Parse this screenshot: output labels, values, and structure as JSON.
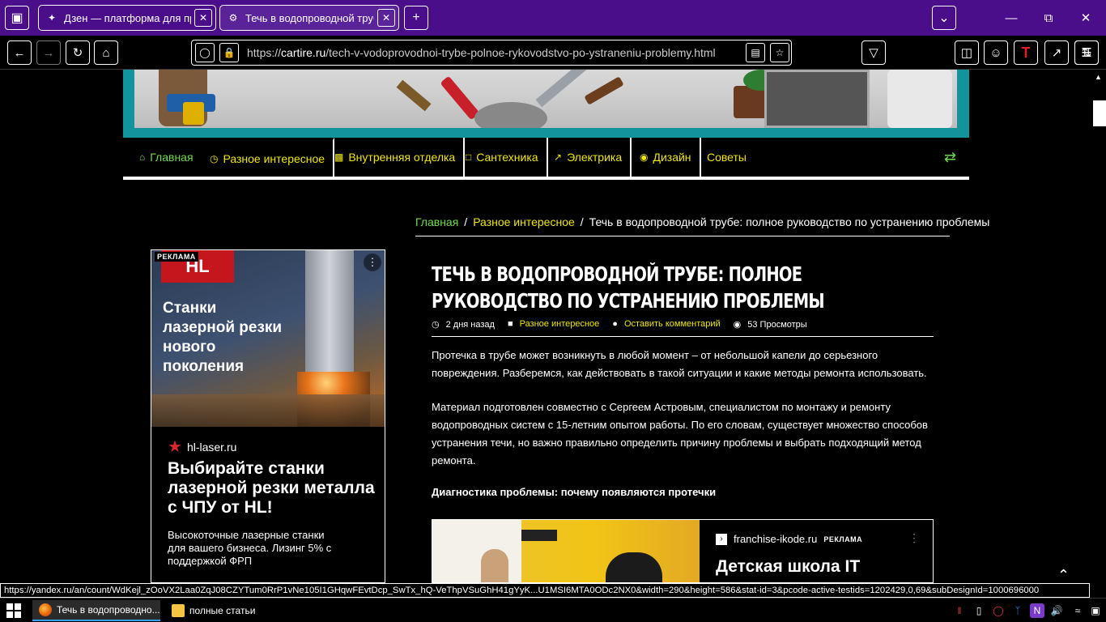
{
  "browser": {
    "tabs": [
      {
        "title": "Дзен — платформа для прос",
        "icon": "dzen-star-icon"
      },
      {
        "title": "Течь в водопроводной трубе",
        "icon": "site-gear-icon"
      }
    ],
    "url_scheme": "https://",
    "url_host": "cartire.ru",
    "url_path": "/tech-v-vodoprovodnoi-trybe-polnoe-rykovodstvo-po-ystraneniu-problemy.html",
    "status_link": "https://yandex.ru/an/count/WdKejl_zOoVX2Laa0ZqJ08CZYTum0RrP1vNe105I1GHqwFEvtDcp_SwTx_hQ-VeThpVSuGhH41gYyK...U1MSI6MTA0ODc2NX0&width=290&height=586&stat-id=3&pcode-active-testids=1202429,0,69&subDesignId=1000696000"
  },
  "site_menu": {
    "items": [
      {
        "label": "Главная",
        "icon": "home-icon"
      },
      {
        "label": "Разное интересное",
        "icon": "clock-icon"
      },
      {
        "label": "Внутренняя отделка",
        "icon": "briefcase-icon"
      },
      {
        "label": "Сантехника",
        "icon": "file-icon"
      },
      {
        "label": "Электрика",
        "icon": "chart-icon"
      },
      {
        "label": "Дизайн",
        "icon": "eye-icon"
      },
      {
        "label": "Советы",
        "icon": ""
      }
    ],
    "random_icon": "shuffle-icon"
  },
  "breadcrumb": {
    "home": "Главная",
    "category": "Разное интересное",
    "current": "Течь в водопроводной трубе: полное руководство по устранению проблемы"
  },
  "article": {
    "title": "Течь в водопроводной трубе: полное руководство по устранению проблемы",
    "meta": {
      "date": "2 дня назад",
      "category": "Разное интересное",
      "comment": "Оставить комментарий",
      "views": "53 Просмотры"
    },
    "paragraph1": "Протечка в трубе может возникнуть в любой момент – от небольшой капели до серьезного повреждения. Разберемся, как действовать в такой ситуации и какие методы ремонта использовать.",
    "paragraph2": "Материал подготовлен совместно с Сергеем Астровым, специалистом по монтажу и ремонту водопроводных систем с 15-летним опытом работы. По его словам, существует множество способов устранения течи, но важно правильно определить причину проблемы и выбрать подходящий метод ремонта.",
    "subheading": "Диагностика проблемы: почему появляются протечки"
  },
  "ad_left": {
    "badge": "РЕКЛАМА",
    "logo": "HL",
    "image_text": "Станки лазерной резки нового поколения",
    "domain": "hl-laser.ru",
    "title": "Выбирайте станки лазерной резки металла с ЧПУ от HL!",
    "description": "Высокоточные лазерные станки для вашего бизнеса. Лизинг 5% с поддержкой ФРП"
  },
  "ad_inline": {
    "domain": "franchise-ikode.ru",
    "badge": "РЕКЛАМА",
    "title": "Детская школа IT"
  },
  "taskbar": {
    "tasks": [
      {
        "label": "Течь в водопроводно...",
        "icon": "firefox-icon"
      },
      {
        "label": "полные статьи",
        "icon": "folder-icon"
      }
    ]
  },
  "colors": {
    "tab_strip": "#4a0e8a",
    "menu_text": "#f0e600",
    "menu_home": "#6fdc4a",
    "banner_frame": "#13939b"
  }
}
